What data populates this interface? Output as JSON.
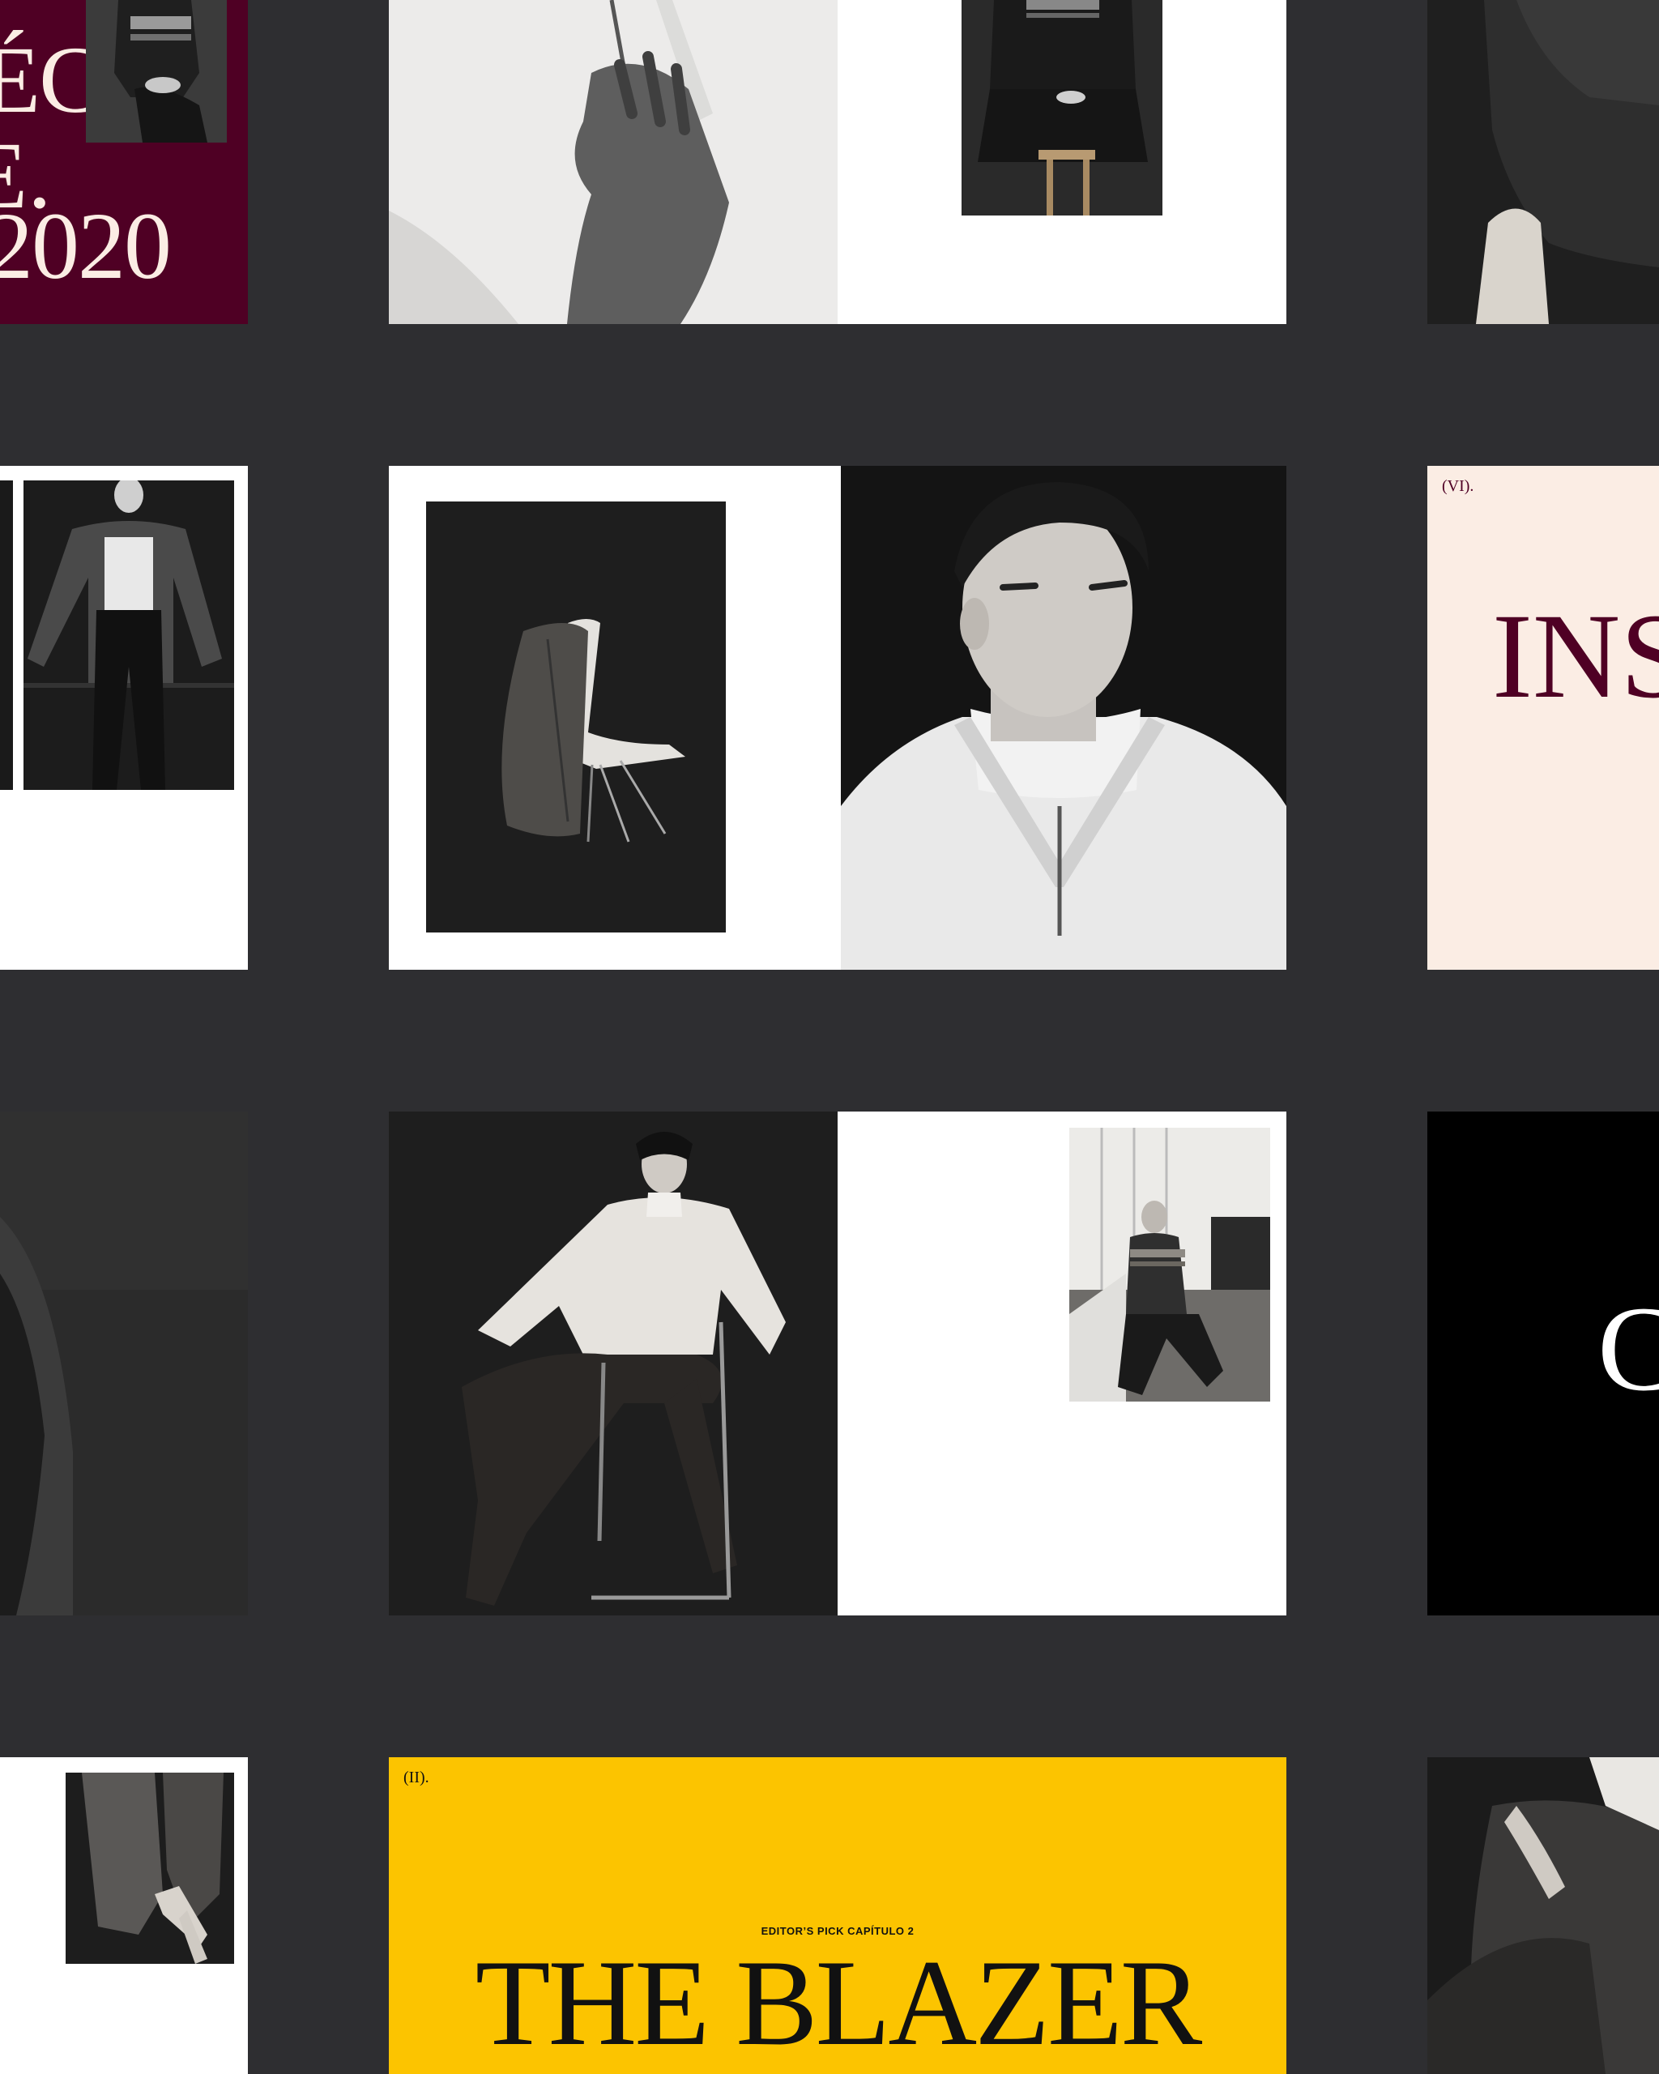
{
  "colors": {
    "background": "#2e2e31",
    "burgundy": "#4f0024",
    "cream": "#fbede4",
    "yellow": "#fcc400",
    "black": "#000000",
    "white": "#ffffff"
  },
  "spreads": {
    "cover": {
      "title_line_1": "ÉCT)",
      "title_line_2": "E.",
      "year": "2020"
    },
    "inspiration": {
      "chapter_numeral": "(VI).",
      "title": "INS"
    },
    "black_opener": {
      "initial": "C"
    },
    "blazer": {
      "chapter_numeral": "(II).",
      "kicker": "EDITOR’S PICK CAPÍTULO 2",
      "title": "THE BLAZER"
    }
  },
  "photos": [
    "portrait-sweater-seated",
    "hand-on-zip-sweater",
    "fair-isle-sweater-seated-stool",
    "dark-coat-with-chair",
    "model-open-coat-walking",
    "trench-coat-on-chair",
    "turtleneck-zip-portrait",
    "tweed-jacket-closeup",
    "seated-chair-turtleneck",
    "fair-isle-sweater-window",
    "blazer-hands-detail",
    "trousers-pocket-detail"
  ]
}
